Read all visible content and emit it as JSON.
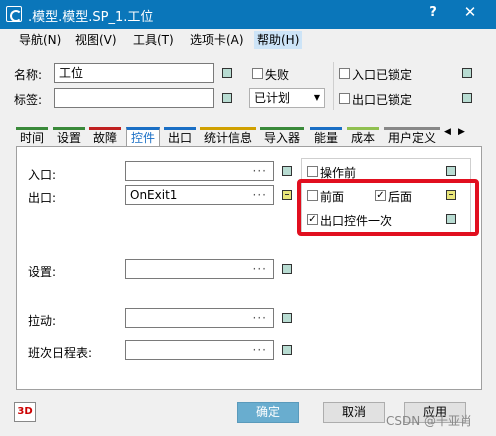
{
  "window": {
    "title": ".模型.模型.SP_1.工位",
    "help_label": "?",
    "close_label": "✕"
  },
  "menu": [
    "导航(N)",
    "视图(V)",
    "工具(T)",
    "选项卡(A)",
    "帮助(H)"
  ],
  "header": {
    "name_label": "名称:",
    "name_value": "工位",
    "tag_label": "标签:",
    "tag_value": "",
    "failed_label": "失败",
    "entrance_locked_label": "入口已锁定",
    "exit_locked_label": "出口已锁定",
    "planned_value": "已计划"
  },
  "tabs": [
    "时间",
    "设置",
    "故障",
    "控件",
    "出口",
    "统计信息",
    "导入器",
    "能量",
    "成本",
    "用户定义"
  ],
  "tab_scroll": {
    "left": "◀",
    "right": "▶"
  },
  "tab_colors": [
    "#3a8a3a",
    "#3a8a3a",
    "#c02020",
    "#1a6fc5",
    "#1a6fc5",
    "#d0a000",
    "#3a8a3a",
    "#1a6fc5",
    "#90c050",
    "#888888"
  ],
  "controls": {
    "entrance_label": "入口:",
    "entrance_value": "",
    "exit_label": "出口:",
    "exit_value": "OnExit1",
    "setup_label": "设置:",
    "setup_value": "",
    "pull_label": "拉动:",
    "pull_value": "",
    "shift_label": "班次日程表:",
    "shift_value": "",
    "ellipsis": "···",
    "before_action_label": "操作前",
    "front_label": "前面",
    "rear_label": "后面",
    "exit_control_once_label": "出口控件一次",
    "rear_checked": "✓",
    "exit_once_checked": "✓"
  },
  "footer": {
    "threed_label": "3D",
    "ok_label": "确定",
    "cancel_label": "取消",
    "apply_label": "应用",
    "watermark": "CSDN @千亚肖"
  }
}
